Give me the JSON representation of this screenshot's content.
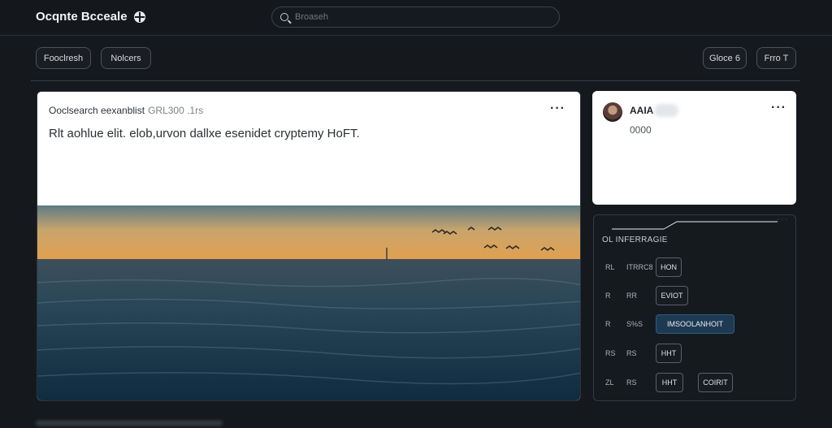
{
  "app": {
    "title": "Ocqnte Bcceale"
  },
  "search": {
    "placeholder": "Broaseh"
  },
  "filters": {
    "left": [
      "Fooclresh",
      "Nolcers"
    ],
    "right": [
      "Gloce 6",
      "Frro T"
    ]
  },
  "post": {
    "author": "Ooclsearch eexanblist",
    "date": "GRL300 .1rs",
    "text": "Rlt aohlue elit. elob,urvon dallxe esenidet cryptemy HoFT.",
    "image": "sunset-ocean-with-birds-sailboat"
  },
  "profile": {
    "name": "AAIA",
    "count": "0000"
  },
  "panel": {
    "title": "OL INFERRAGIE",
    "rows": [
      {
        "c1": "RL",
        "c2": "ITRRC8",
        "tags": [
          "HON"
        ],
        "active": []
      },
      {
        "c1": "R",
        "c2": "RR",
        "tags": [
          "EVIOT"
        ],
        "active": []
      },
      {
        "c1": "R",
        "c2": "S%S",
        "tags": [
          "IMSOOLANHOIT"
        ],
        "active": [
          0
        ]
      },
      {
        "c1": "RS",
        "c2": "RS",
        "tags": [
          "HHT"
        ],
        "active": []
      },
      {
        "c1": "ZL",
        "c2": "RS",
        "tags": [
          "HHT",
          "COIRIT"
        ],
        "active": []
      }
    ]
  },
  "colors": {
    "background": "#15191e",
    "accent_active_tag": "#1e3a52"
  }
}
